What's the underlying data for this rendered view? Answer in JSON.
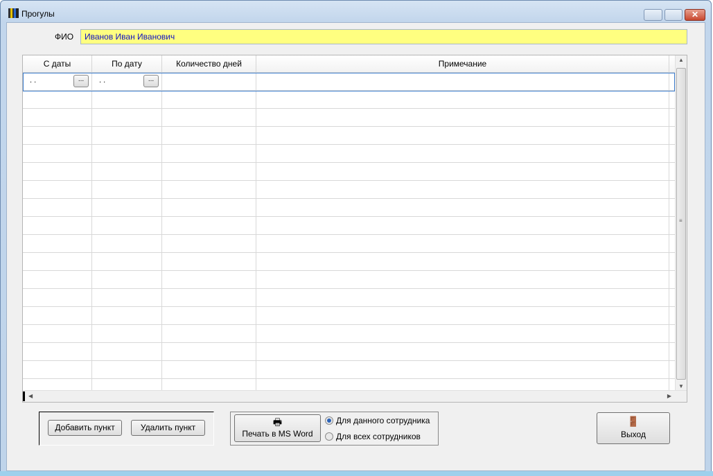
{
  "window": {
    "title": "Прогулы"
  },
  "form": {
    "fio_label": "ФИО",
    "fio_value": "Иванов Иван Иванович"
  },
  "grid": {
    "columns": [
      "С даты",
      "По дату",
      "Количество дней",
      "Примечание"
    ],
    "first_row": {
      "from_date": ". .",
      "to_date": ". .",
      "picker_label": "..."
    },
    "row_count": 18
  },
  "actions": {
    "add": "Добавить пункт",
    "delete": "Удалить пункт",
    "print": "Печать в MS Word",
    "exit": "Выход"
  },
  "print_scope": {
    "options": [
      "Для данного сотрудника",
      "Для всех сотрудников"
    ],
    "selected": 0
  }
}
